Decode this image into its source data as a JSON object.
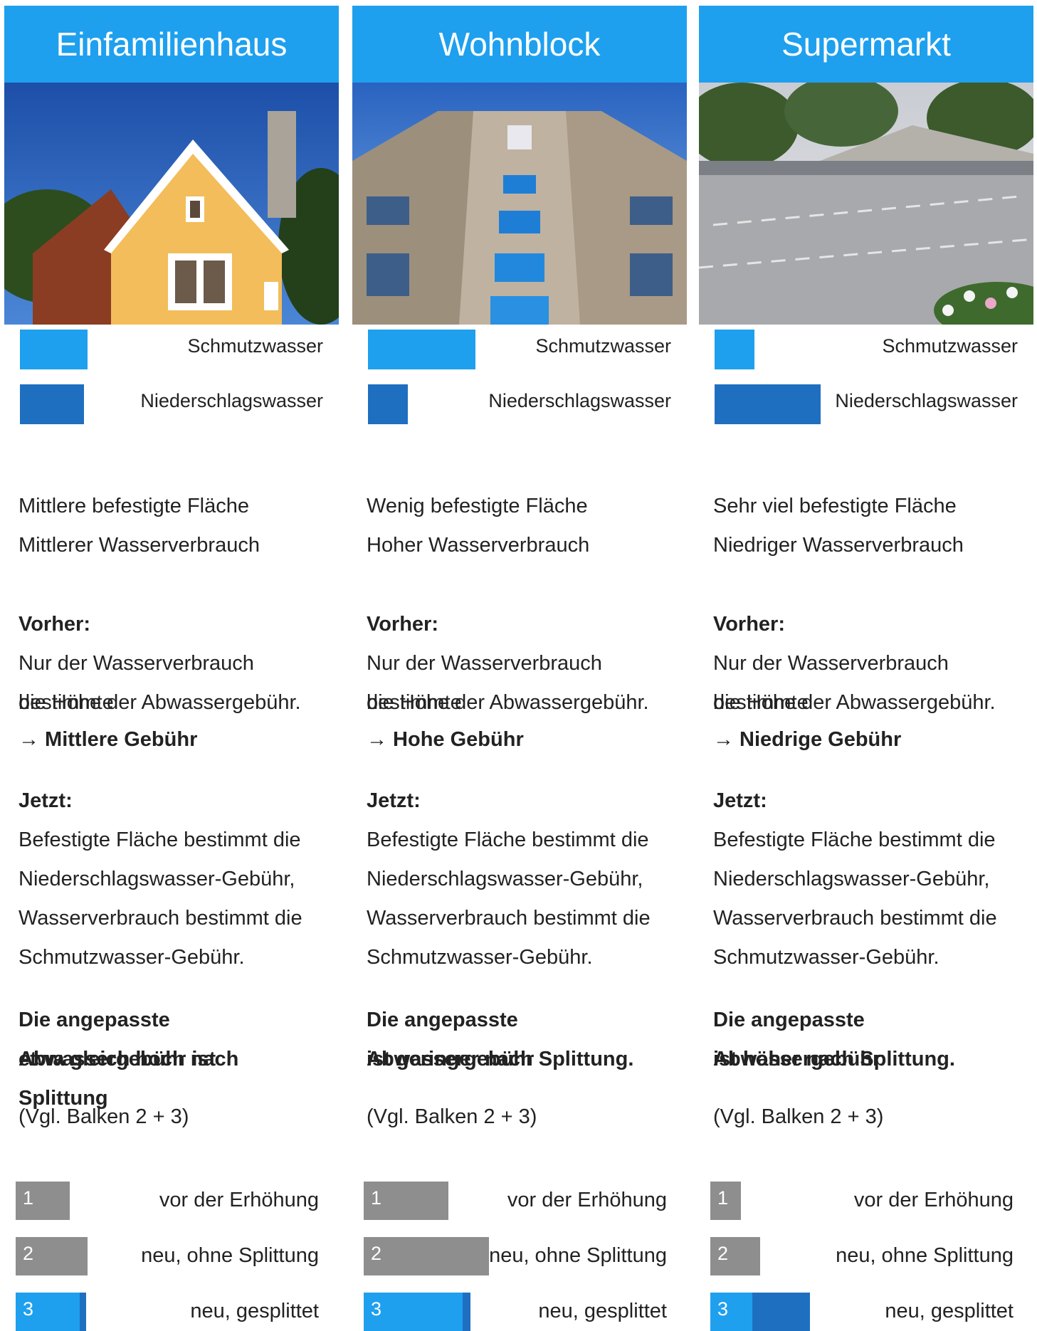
{
  "colors": {
    "header": "#1ea0ee",
    "schmutzwasser": "#1ea0ee",
    "niederschlagswasser": "#1f6fc0",
    "bar_grey": "#8e8e8e"
  },
  "columns": [
    {
      "title": "Einfamilienhaus",
      "legend": {
        "schmutz_label": "Schmutzwasser",
        "schmutz_ratio": 0.53,
        "nieder_label": "Niederschlagswasser",
        "nieder_ratio": 0.5
      },
      "area_text": "Mittlere befestigte Fläche",
      "consumption_text": "Mittlerer Wasserverbrauch",
      "vorher_heading": "Vorher:",
      "vorher_line1": "Nur der Wasserverbrauch bestimmte",
      "vorher_line2": "die Höhe der Abwassergebühr.",
      "vorher_result": "→ Mittlere Gebühr",
      "jetzt_heading": "Jetzt:",
      "jetzt_line1": "Befestigte Fläche bestimmt die",
      "jetzt_line2": "Niederschlagswasser-Gebühr,",
      "jetzt_line3": "Wasserverbrauch bestimmt die",
      "jetzt_line4": "Schmutzwasser-Gebühr.",
      "conclusion_line1": "Die angepasste Abwassergebühr ist",
      "conclusion_line2": "etwa gleich hoch nach Splittung",
      "vgl": "(Vgl. Balken 2 + 3)",
      "bars": [
        {
          "number": "1",
          "label": "vor der Erhöhung",
          "grey": 0.42
        },
        {
          "number": "2",
          "label": "neu, ohne Splittung",
          "grey": 0.56
        },
        {
          "number": "3",
          "label": "neu, gesplittet",
          "light": 0.5,
          "dark": 0.05
        }
      ]
    },
    {
      "title": "Wohnblock",
      "legend": {
        "schmutz_label": "Schmutzwasser",
        "schmutz_ratio": 0.84,
        "nieder_label": "Niederschlagswasser",
        "nieder_ratio": 0.31
      },
      "area_text": "Wenig befestigte Fläche",
      "consumption_text": "Hoher Wasserverbrauch",
      "vorher_heading": "Vorher:",
      "vorher_line1": "Nur der Wasserverbrauch bestimmte",
      "vorher_line2": "die Höhe der Abwassergebühr.",
      "vorher_result": "→ Hohe Gebühr",
      "jetzt_heading": "Jetzt:",
      "jetzt_line1": "Befestigte Fläche bestimmt die",
      "jetzt_line2": "Niederschlagswasser-Gebühr,",
      "jetzt_line3": "Wasserverbrauch bestimmt die",
      "jetzt_line4": "Schmutzwasser-Gebühr.",
      "conclusion_line1": "Die angepasste Abwassergebühr",
      "conclusion_line2": "ist geringer nach Splittung.",
      "vgl": "(Vgl. Balken 2 + 3)",
      "bars": [
        {
          "number": "1",
          "label": "vor der Erhöhung",
          "grey": 0.66
        },
        {
          "number": "2",
          "label": "neu, ohne Splittung",
          "grey": 0.98
        },
        {
          "number": "3",
          "label": "neu, gesplittet",
          "light": 0.77,
          "dark": 0.06
        }
      ]
    },
    {
      "title": "Supermarkt",
      "legend": {
        "schmutz_label": "Schmutzwasser",
        "schmutz_ratio": 0.31,
        "nieder_label": "Niederschlagswasser",
        "nieder_ratio": 0.83
      },
      "area_text": "Sehr viel befestigte Fläche",
      "consumption_text": "Niedriger Wasserverbrauch",
      "vorher_heading": "Vorher:",
      "vorher_line1": "Nur der Wasserverbrauch bestimmte",
      "vorher_line2": "die Höhe der Abwassergebühr.",
      "vorher_result": "→ Niedrige Gebühr",
      "jetzt_heading": "Jetzt:",
      "jetzt_line1": "Befestigte Fläche bestimmt die",
      "jetzt_line2": "Niederschlagswasser-Gebühr,",
      "jetzt_line3": "Wasserverbrauch bestimmt die",
      "jetzt_line4": "Schmutzwasser-Gebühr.",
      "conclusion_line1": "Die angepasste Abwassergebühr",
      "conclusion_line2": "ist höher nach Splittung.",
      "vgl": "(Vgl. Balken 2 + 3)",
      "bars": [
        {
          "number": "1",
          "label": "vor der Erhöhung",
          "grey": 0.24
        },
        {
          "number": "2",
          "label": "neu, ohne Splittung",
          "grey": 0.39
        },
        {
          "number": "3",
          "label": "neu, gesplittet",
          "light": 0.33,
          "dark": 0.45
        }
      ]
    }
  ]
}
